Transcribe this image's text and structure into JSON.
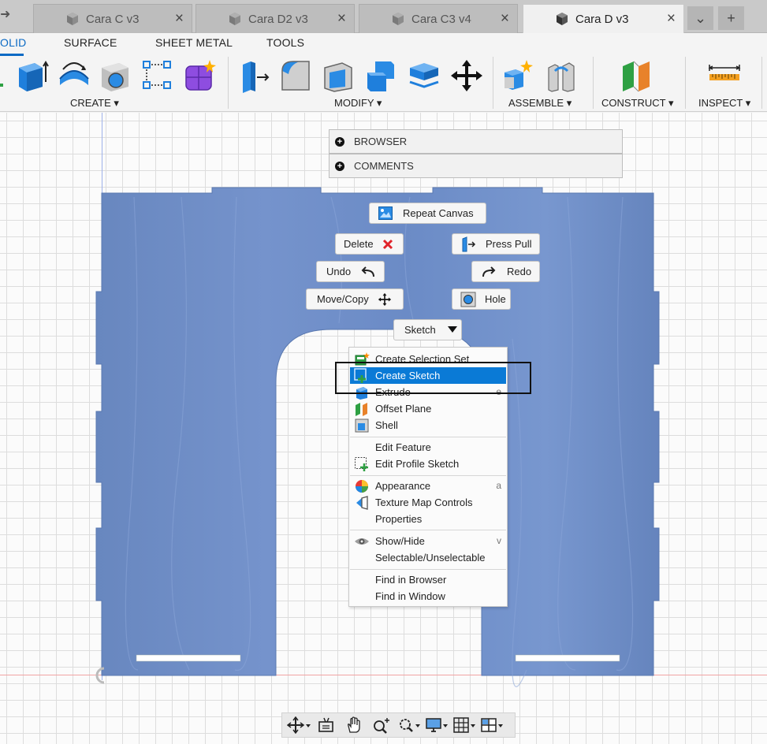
{
  "tabs": [
    {
      "label": "Cara C v3",
      "active": false
    },
    {
      "label": "Cara D2 v3",
      "active": false
    },
    {
      "label": "Cara C3 v4",
      "active": false
    },
    {
      "label": "Cara D v3",
      "active": true
    }
  ],
  "tab_close": "×",
  "tab_overflow_glyph": "⌄",
  "tab_add_glyph": "+",
  "workspace_tabs": [
    "OLID",
    "SURFACE",
    "SHEET METAL",
    "TOOLS"
  ],
  "groups": {
    "create": "CREATE ▾",
    "modify": "MODIFY ▾",
    "assemble": "ASSEMBLE ▾",
    "construct": "CONSTRUCT ▾",
    "inspect": "INSPECT ▾"
  },
  "panels": {
    "browser": "BROWSER",
    "comments": "COMMENTS",
    "plus": "+"
  },
  "marking_menu": {
    "repeat": "Repeat Canvas",
    "delete": "Delete",
    "press_pull": "Press Pull",
    "undo": "Undo",
    "redo": "Redo",
    "move_copy": "Move/Copy",
    "hole": "Hole",
    "sketch": "Sketch"
  },
  "context_menu": [
    {
      "label": "Create Selection Set",
      "icon": "selection-set-icon"
    },
    {
      "label": "Create Sketch",
      "icon": "create-sketch-icon",
      "highlight": true
    },
    {
      "label": "Extrude",
      "icon": "extrude-icon",
      "shortcut": "e"
    },
    {
      "label": "Offset Plane",
      "icon": "offset-plane-icon"
    },
    {
      "label": "Shell",
      "icon": "shell-icon"
    },
    {
      "label": "Edit Feature",
      "icon": ""
    },
    {
      "label": "Edit Profile Sketch",
      "icon": "edit-profile-sketch-icon"
    },
    {
      "label": "Appearance",
      "icon": "appearance-icon",
      "shortcut": "a"
    },
    {
      "label": "Texture Map Controls",
      "icon": "texture-map-icon"
    },
    {
      "label": "Properties",
      "icon": ""
    },
    {
      "label": "Show/Hide",
      "icon": "eye-icon",
      "shortcut": "v"
    },
    {
      "label": "Selectable/Unselectable",
      "icon": ""
    },
    {
      "label": "Find in Browser",
      "icon": ""
    },
    {
      "label": "Find in Window",
      "icon": ""
    }
  ],
  "colors": {
    "accent": "#0b6ac4",
    "menu_highlight": "#0a7ad6",
    "wood_fill": "#6b8ec6",
    "construct_green": "#2ea043",
    "construct_orange": "#e8822a",
    "delete_red": "#e0232a"
  }
}
